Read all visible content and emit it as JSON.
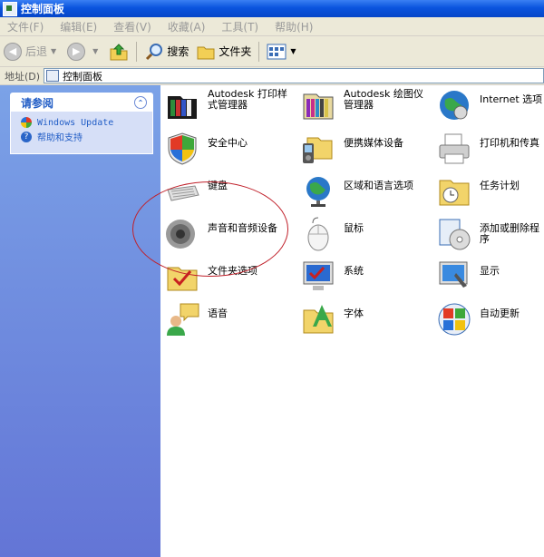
{
  "window": {
    "title": "控制面板"
  },
  "menu": [
    "文件(F)",
    "编辑(E)",
    "查看(V)",
    "收藏(A)",
    "工具(T)",
    "帮助(H)"
  ],
  "toolbar": {
    "back": "后退",
    "search": "搜索",
    "folders": "文件夹"
  },
  "address": {
    "label": "地址(D)",
    "value": "控制面板"
  },
  "see_also": {
    "title": "请参阅",
    "links": [
      "Windows Update",
      "帮助和支持"
    ]
  },
  "items": [
    {
      "label": "Autodesk 打印样式管理器",
      "icon": "print-style-manager-icon"
    },
    {
      "label": "Autodesk 绘图仪管理器",
      "icon": "plotter-manager-icon"
    },
    {
      "label": "Internet 选项",
      "icon": "internet-options-icon"
    },
    {
      "label": "安全中心",
      "icon": "security-shield-icon"
    },
    {
      "label": "便携媒体设备",
      "icon": "portable-media-icon"
    },
    {
      "label": "打印机和传真",
      "icon": "printer-icon"
    },
    {
      "label": "键盘",
      "icon": "keyboard-icon"
    },
    {
      "label": "区域和语言选项",
      "icon": "globe-icon"
    },
    {
      "label": "任务计划",
      "icon": "scheduled-tasks-icon"
    },
    {
      "label": "声音和音频设备",
      "icon": "speaker-icon"
    },
    {
      "label": "鼠标",
      "icon": "mouse-icon"
    },
    {
      "label": "添加或删除程序",
      "icon": "add-remove-programs-icon"
    },
    {
      "label": "文件夹选项",
      "icon": "folder-options-icon"
    },
    {
      "label": "系统",
      "icon": "system-icon"
    },
    {
      "label": "显示",
      "icon": "display-icon"
    },
    {
      "label": "语音",
      "icon": "speech-icon"
    },
    {
      "label": "字体",
      "icon": "fonts-folder-icon"
    },
    {
      "label": "自动更新",
      "icon": "windows-update-icon"
    }
  ],
  "colors": {
    "annotation_circle": "#c0202a",
    "sidebar": "#6f8fe0",
    "link": "#215dc6"
  }
}
